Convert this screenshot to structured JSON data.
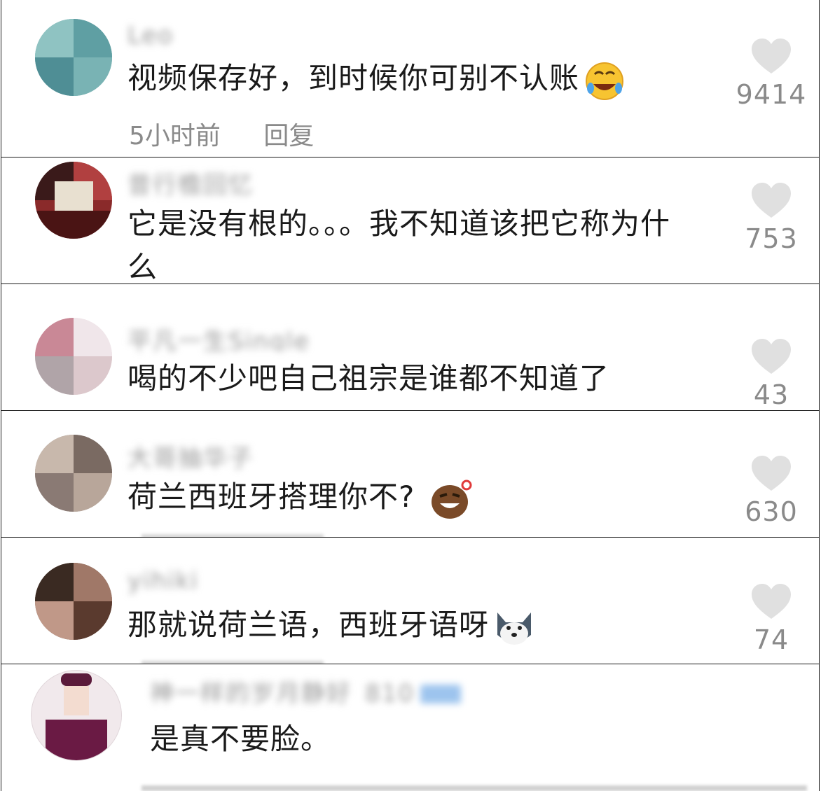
{
  "comments": [
    {
      "username": "Leo",
      "text": "视频保存好，到时候你可别不认账",
      "time": "5小时前",
      "reply_label": "回复",
      "likes": "9414",
      "emoji": "rofl-icon"
    },
    {
      "username": "昔行檐回忆",
      "text": "它是没有根的。。。我不知道该把它称为什么",
      "likes": "753"
    },
    {
      "username": "平凡一生Single",
      "text": "喝的不少吧自己祖宗是谁都不知道了",
      "likes": "43"
    },
    {
      "username": "大哥抽华子",
      "text": "荷兰西班牙搭理你不?",
      "likes": "630",
      "emoji": "grin-face-icon"
    },
    {
      "username": "yihiki",
      "text": "那就说荷兰语，西班牙语呀",
      "likes": "74",
      "emoji": "husky-icon"
    },
    {
      "username": "神一样的岁月静好_810",
      "text": "是真不要脸。"
    }
  ],
  "colors": {
    "text": "#1a1a1a",
    "muted": "#8a8a8a",
    "heart": "#e0e0e0"
  }
}
